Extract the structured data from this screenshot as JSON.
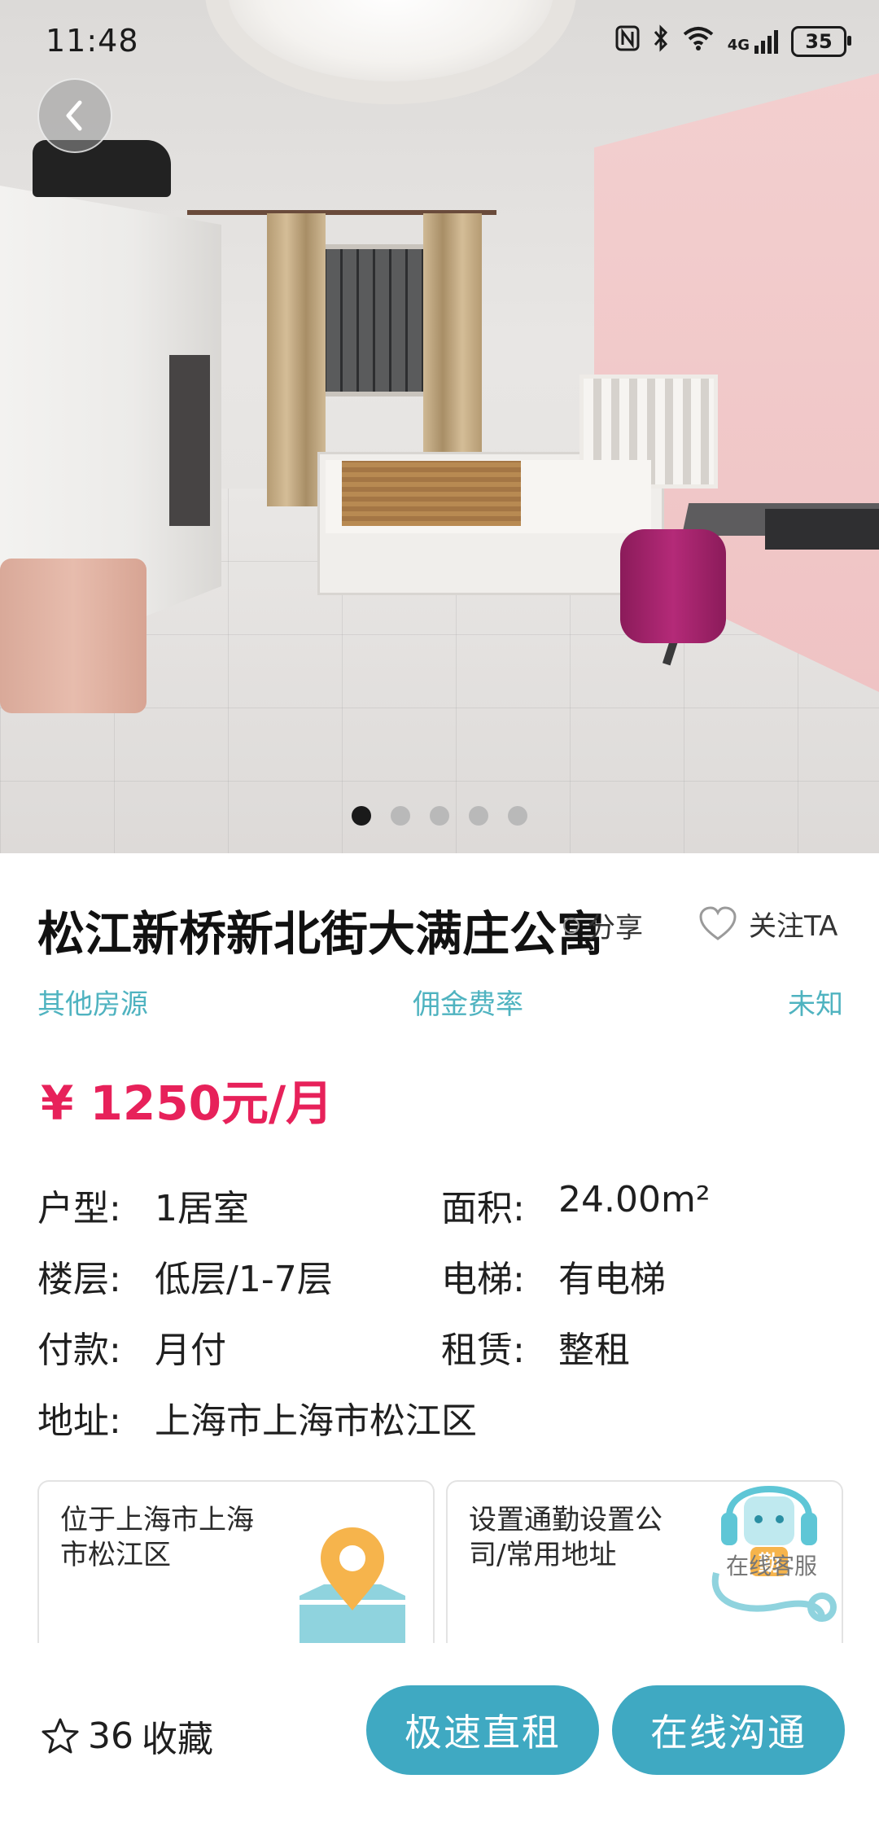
{
  "status_bar": {
    "time": "11:48",
    "battery": "35",
    "network": "4G"
  },
  "gallery": {
    "total": 5,
    "active_index": 0
  },
  "listing": {
    "title": "松江新桥新北街大满庄公寓",
    "share_label": "分享",
    "follow_label": "关注TA",
    "meta": {
      "source": "其他房源",
      "commission_label": "佣金费率",
      "commission_value": "未知"
    },
    "price": "¥ 1250元/月"
  },
  "specs": {
    "layout_label": "户型:",
    "layout_value": "1居室",
    "area_label": "面积:",
    "area_value": "24.00m²",
    "floor_label": "楼层:",
    "floor_value": "低层/1-7层",
    "elevator_label": "电梯:",
    "elevator_value": "有电梯",
    "payment_label": "付款:",
    "payment_value": "月付",
    "lease_label": "租赁:",
    "lease_value": "整租",
    "address_label": "地址:",
    "address_value": "上海市上海市松江区"
  },
  "cards": {
    "location_text": "位于上海市上海市松江区",
    "commute_text": "设置通勤设置公司/常用地址"
  },
  "support": {
    "label": "在线客服",
    "badge": "勤"
  },
  "bottom_bar": {
    "favorite_count": "36",
    "favorite_label": "收藏",
    "quick_rent_label": "极速直租",
    "chat_label": "在线沟通"
  },
  "colors": {
    "accent": "#3fa9c2",
    "price": "#e7215a",
    "meta": "#4fb3c0"
  },
  "icons": [
    "back-arrow-icon",
    "share-icon",
    "heart-icon",
    "map-pin-icon",
    "headset-icon",
    "star-icon",
    "wifi-icon",
    "bluetooth-icon",
    "nfc-icon",
    "signal-icon",
    "battery-icon"
  ]
}
